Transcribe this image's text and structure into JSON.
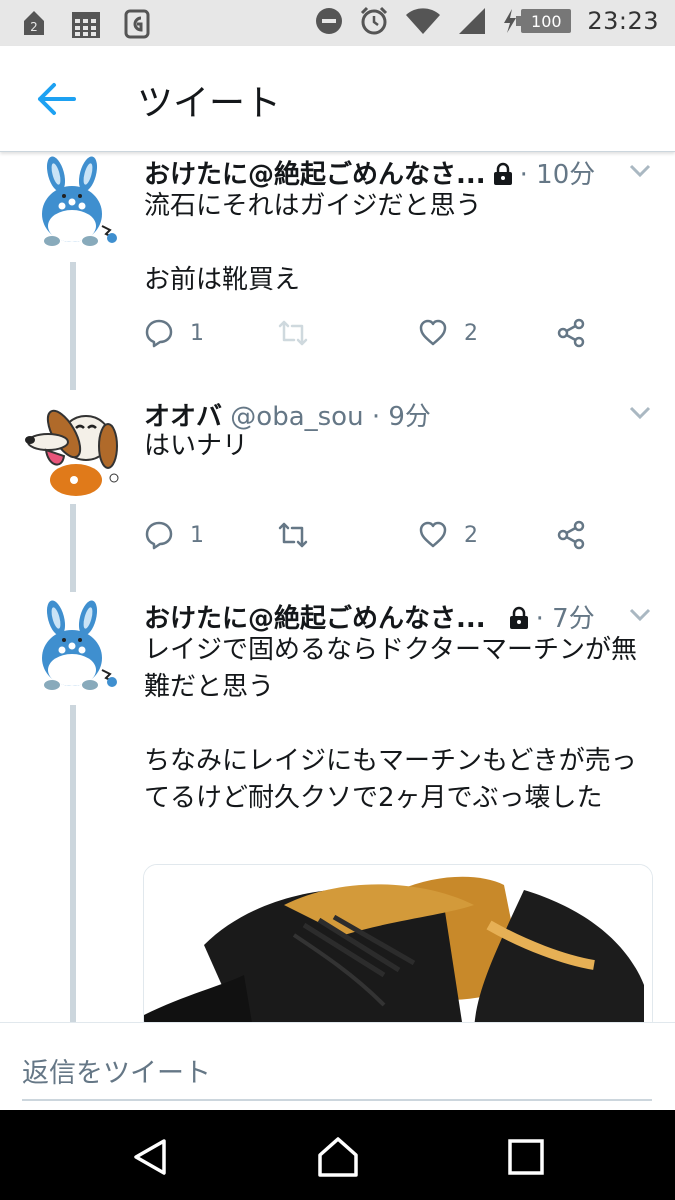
{
  "status_bar": {
    "time": "23:23",
    "battery": "100",
    "left_icons": [
      "notification-badge-icon",
      "calendar-icon",
      "app-icon"
    ],
    "right_icons": [
      "do-not-disturb-icon",
      "alarm-icon",
      "wifi-icon",
      "signal-icon",
      "battery-charging-icon"
    ]
  },
  "app_bar": {
    "title": "ツイート",
    "back_icon": "arrow-left-icon",
    "accent": "#1da1f2"
  },
  "tweets": [
    {
      "name": "おけたに@絶起ごめんなさ...",
      "handle": "",
      "protected": true,
      "time": "10分",
      "text": "流石にそれはガイジだと思う\n\nお前は靴買え",
      "replies": "1",
      "retweets": "",
      "likes": "2",
      "avatar": "azumarill-avatar"
    },
    {
      "name": "オオバ",
      "handle": "@oba_sou",
      "protected": false,
      "time": "9分",
      "text": "はいナリ",
      "replies": "1",
      "retweets": "",
      "likes": "2",
      "avatar": "dog-avatar"
    },
    {
      "name": "おけたに@絶起ごめんなさ...",
      "handle": "",
      "protected": true,
      "time": "7分",
      "text": "レイジで固めるならドクターマーチンが無難だと思う\n\nちなみにレイジにもマーチンもどきが売ってるけど耐久クソで2ヶ月でぶっ壊した",
      "avatar": "azumarill-avatar",
      "media": "black-leather-shoes-image"
    }
  ],
  "reply_bar": {
    "placeholder": "返信をツイート"
  },
  "nav_bar": {
    "buttons": [
      "back-triangle-icon",
      "home-icon",
      "recents-icon"
    ]
  },
  "colors": {
    "status_bar_bg": "#e7e7e7",
    "text_primary": "#14171a",
    "text_secondary": "#657786",
    "thread_line": "#ccd6dd"
  }
}
